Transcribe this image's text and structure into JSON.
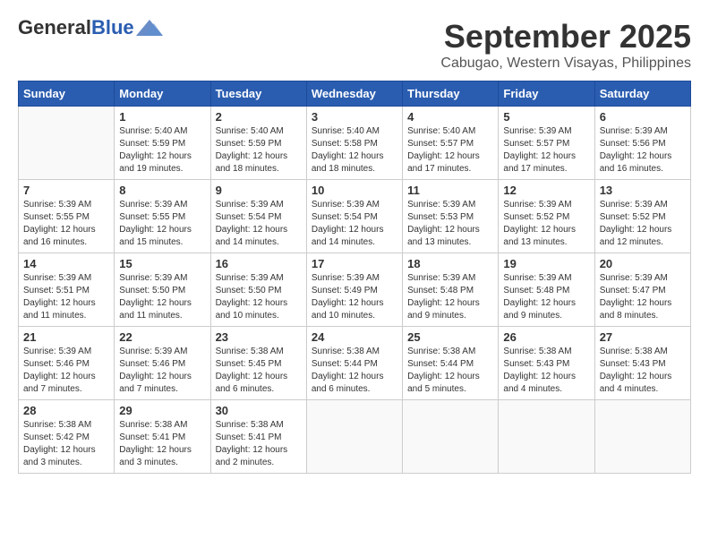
{
  "header": {
    "logo": {
      "general": "General",
      "blue": "Blue"
    },
    "title": "September 2025",
    "subtitle": "Cabugao, Western Visayas, Philippines"
  },
  "calendar": {
    "days_of_week": [
      "Sunday",
      "Monday",
      "Tuesday",
      "Wednesday",
      "Thursday",
      "Friday",
      "Saturday"
    ],
    "weeks": [
      [
        {
          "day": "",
          "info": ""
        },
        {
          "day": "1",
          "info": "Sunrise: 5:40 AM\nSunset: 5:59 PM\nDaylight: 12 hours\nand 19 minutes."
        },
        {
          "day": "2",
          "info": "Sunrise: 5:40 AM\nSunset: 5:59 PM\nDaylight: 12 hours\nand 18 minutes."
        },
        {
          "day": "3",
          "info": "Sunrise: 5:40 AM\nSunset: 5:58 PM\nDaylight: 12 hours\nand 18 minutes."
        },
        {
          "day": "4",
          "info": "Sunrise: 5:40 AM\nSunset: 5:57 PM\nDaylight: 12 hours\nand 17 minutes."
        },
        {
          "day": "5",
          "info": "Sunrise: 5:39 AM\nSunset: 5:57 PM\nDaylight: 12 hours\nand 17 minutes."
        },
        {
          "day": "6",
          "info": "Sunrise: 5:39 AM\nSunset: 5:56 PM\nDaylight: 12 hours\nand 16 minutes."
        }
      ],
      [
        {
          "day": "7",
          "info": "Sunrise: 5:39 AM\nSunset: 5:55 PM\nDaylight: 12 hours\nand 16 minutes."
        },
        {
          "day": "8",
          "info": "Sunrise: 5:39 AM\nSunset: 5:55 PM\nDaylight: 12 hours\nand 15 minutes."
        },
        {
          "day": "9",
          "info": "Sunrise: 5:39 AM\nSunset: 5:54 PM\nDaylight: 12 hours\nand 14 minutes."
        },
        {
          "day": "10",
          "info": "Sunrise: 5:39 AM\nSunset: 5:54 PM\nDaylight: 12 hours\nand 14 minutes."
        },
        {
          "day": "11",
          "info": "Sunrise: 5:39 AM\nSunset: 5:53 PM\nDaylight: 12 hours\nand 13 minutes."
        },
        {
          "day": "12",
          "info": "Sunrise: 5:39 AM\nSunset: 5:52 PM\nDaylight: 12 hours\nand 13 minutes."
        },
        {
          "day": "13",
          "info": "Sunrise: 5:39 AM\nSunset: 5:52 PM\nDaylight: 12 hours\nand 12 minutes."
        }
      ],
      [
        {
          "day": "14",
          "info": "Sunrise: 5:39 AM\nSunset: 5:51 PM\nDaylight: 12 hours\nand 11 minutes."
        },
        {
          "day": "15",
          "info": "Sunrise: 5:39 AM\nSunset: 5:50 PM\nDaylight: 12 hours\nand 11 minutes."
        },
        {
          "day": "16",
          "info": "Sunrise: 5:39 AM\nSunset: 5:50 PM\nDaylight: 12 hours\nand 10 minutes."
        },
        {
          "day": "17",
          "info": "Sunrise: 5:39 AM\nSunset: 5:49 PM\nDaylight: 12 hours\nand 10 minutes."
        },
        {
          "day": "18",
          "info": "Sunrise: 5:39 AM\nSunset: 5:48 PM\nDaylight: 12 hours\nand 9 minutes."
        },
        {
          "day": "19",
          "info": "Sunrise: 5:39 AM\nSunset: 5:48 PM\nDaylight: 12 hours\nand 9 minutes."
        },
        {
          "day": "20",
          "info": "Sunrise: 5:39 AM\nSunset: 5:47 PM\nDaylight: 12 hours\nand 8 minutes."
        }
      ],
      [
        {
          "day": "21",
          "info": "Sunrise: 5:39 AM\nSunset: 5:46 PM\nDaylight: 12 hours\nand 7 minutes."
        },
        {
          "day": "22",
          "info": "Sunrise: 5:39 AM\nSunset: 5:46 PM\nDaylight: 12 hours\nand 7 minutes."
        },
        {
          "day": "23",
          "info": "Sunrise: 5:38 AM\nSunset: 5:45 PM\nDaylight: 12 hours\nand 6 minutes."
        },
        {
          "day": "24",
          "info": "Sunrise: 5:38 AM\nSunset: 5:44 PM\nDaylight: 12 hours\nand 6 minutes."
        },
        {
          "day": "25",
          "info": "Sunrise: 5:38 AM\nSunset: 5:44 PM\nDaylight: 12 hours\nand 5 minutes."
        },
        {
          "day": "26",
          "info": "Sunrise: 5:38 AM\nSunset: 5:43 PM\nDaylight: 12 hours\nand 4 minutes."
        },
        {
          "day": "27",
          "info": "Sunrise: 5:38 AM\nSunset: 5:43 PM\nDaylight: 12 hours\nand 4 minutes."
        }
      ],
      [
        {
          "day": "28",
          "info": "Sunrise: 5:38 AM\nSunset: 5:42 PM\nDaylight: 12 hours\nand 3 minutes."
        },
        {
          "day": "29",
          "info": "Sunrise: 5:38 AM\nSunset: 5:41 PM\nDaylight: 12 hours\nand 3 minutes."
        },
        {
          "day": "30",
          "info": "Sunrise: 5:38 AM\nSunset: 5:41 PM\nDaylight: 12 hours\nand 2 minutes."
        },
        {
          "day": "",
          "info": ""
        },
        {
          "day": "",
          "info": ""
        },
        {
          "day": "",
          "info": ""
        },
        {
          "day": "",
          "info": ""
        }
      ]
    ]
  }
}
